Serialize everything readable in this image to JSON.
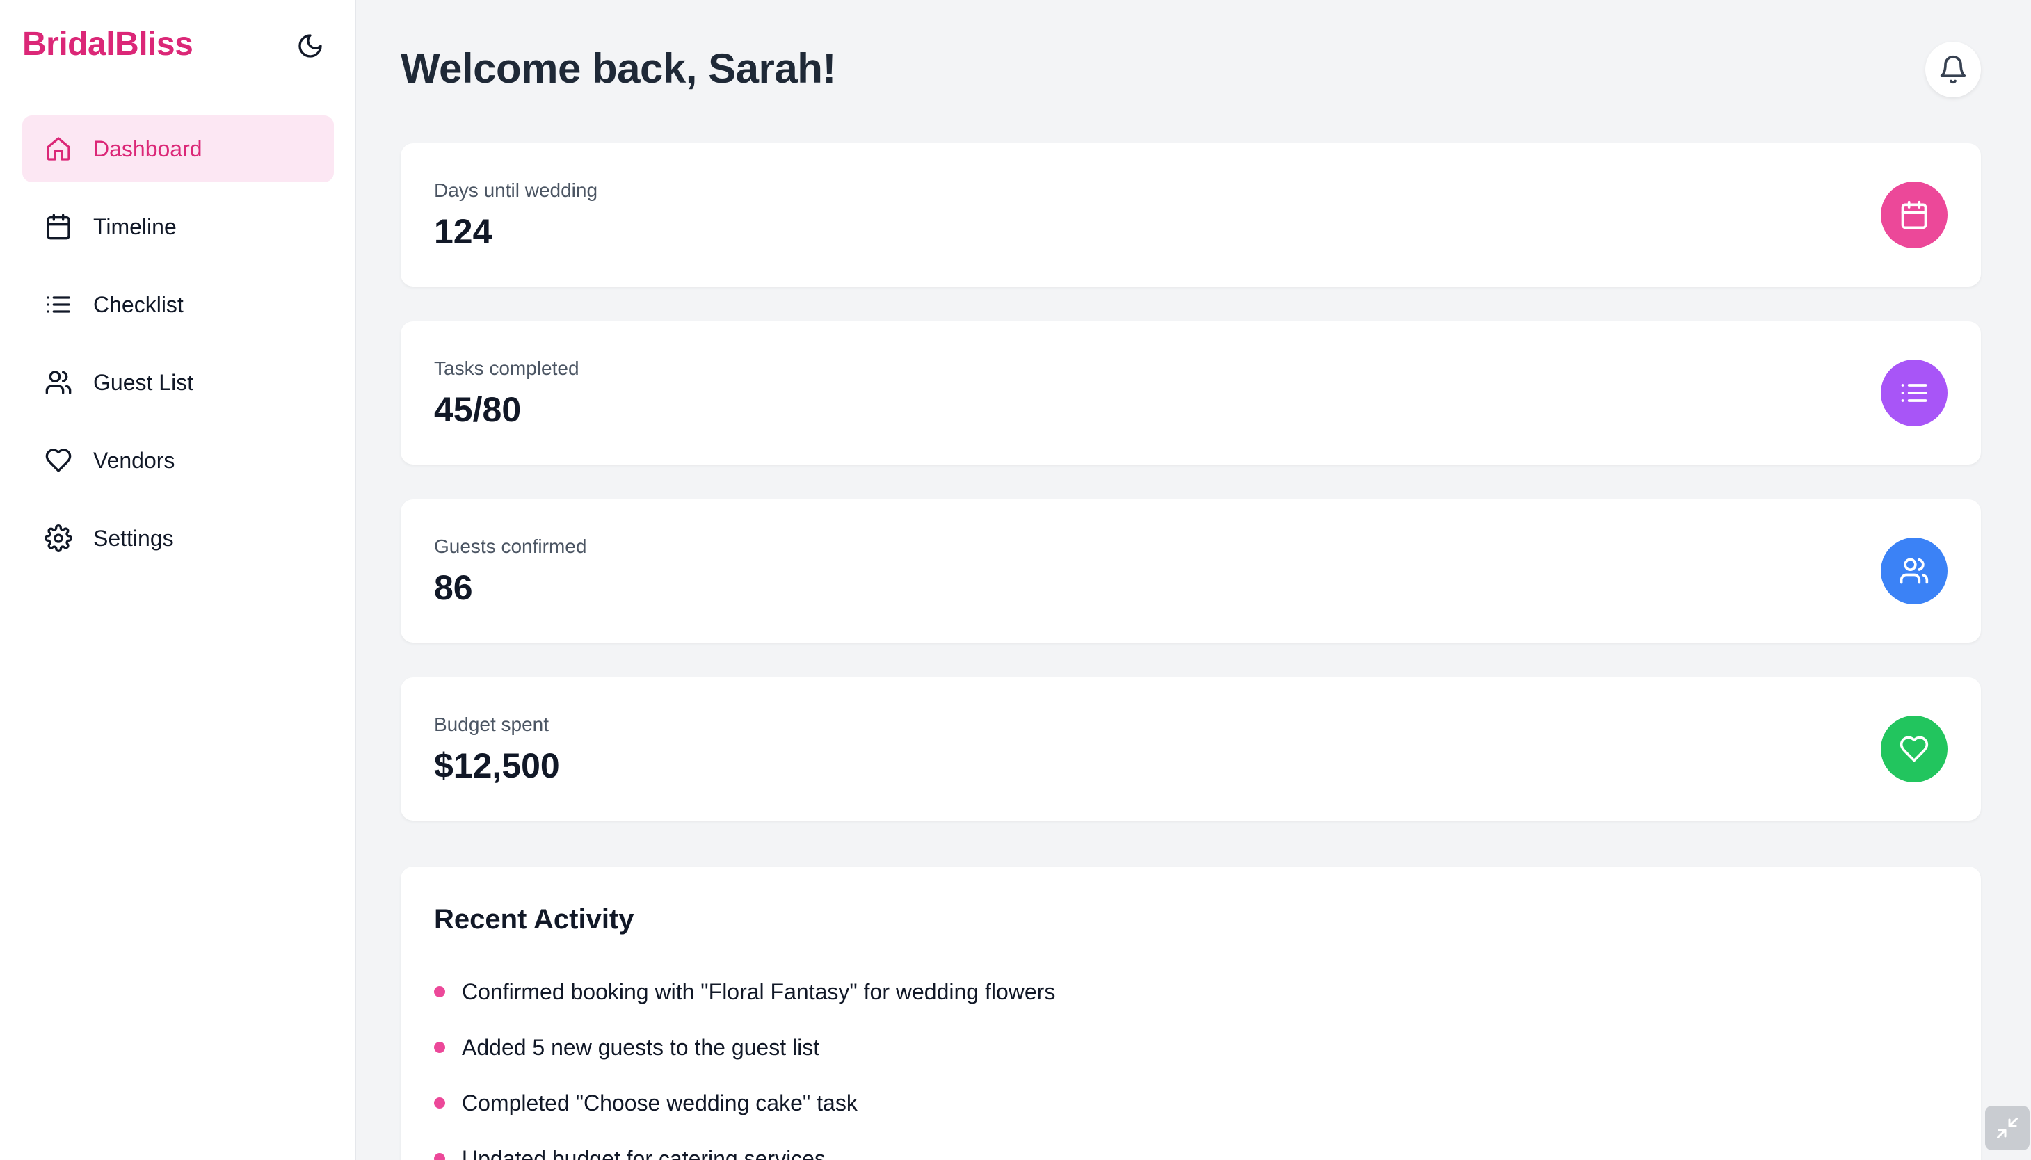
{
  "brand": {
    "name": "BridalBliss",
    "color": "#db2777"
  },
  "sidebar": {
    "theme_toggle_icon": "moon-icon",
    "items": [
      {
        "label": "Dashboard",
        "icon": "home-icon",
        "active": true
      },
      {
        "label": "Timeline",
        "icon": "calendar-icon",
        "active": false
      },
      {
        "label": "Checklist",
        "icon": "list-icon",
        "active": false
      },
      {
        "label": "Guest List",
        "icon": "users-icon",
        "active": false
      },
      {
        "label": "Vendors",
        "icon": "heart-icon",
        "active": false
      },
      {
        "label": "Settings",
        "icon": "gear-icon",
        "active": false
      }
    ]
  },
  "header": {
    "title": "Welcome back, Sarah!",
    "notification_icon": "bell-icon"
  },
  "stats": [
    {
      "label": "Days until wedding",
      "value": "124",
      "icon": "calendar-icon",
      "color": "#ec4899"
    },
    {
      "label": "Tasks completed",
      "value": "45/80",
      "icon": "list-icon",
      "color": "#a855f7"
    },
    {
      "label": "Guests confirmed",
      "value": "86",
      "icon": "users-icon",
      "color": "#3b82f6"
    },
    {
      "label": "Budget spent",
      "value": "$12,500",
      "icon": "heart-icon",
      "color": "#22c55e"
    }
  ],
  "activity": {
    "title": "Recent Activity",
    "bullet_color": "#ec4899",
    "items": [
      "Confirmed booking with \"Floral Fantasy\" for wedding flowers",
      "Added 5 new guests to the guest list",
      "Completed \"Choose wedding cake\" task",
      "Updated budget for catering services"
    ]
  },
  "corner_button_icon": "collapse-icon"
}
